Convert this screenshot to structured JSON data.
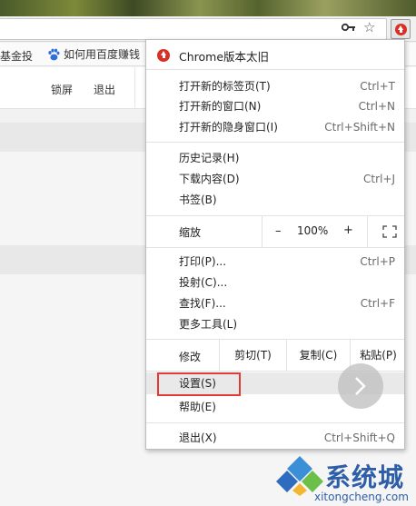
{
  "bookmarks": {
    "item1": "基金投",
    "item2": "如何用百度赚钱"
  },
  "page": {
    "lock_label": "锁屏",
    "exit_label": "退出"
  },
  "menu": {
    "update": {
      "label": "Chrome版本太旧",
      "icon": "update-icon",
      "color": "#d93025"
    },
    "new_tab": {
      "label": "打开新的标签页(T)",
      "shortcut": "Ctrl+T"
    },
    "new_window": {
      "label": "打开新的窗口(N)",
      "shortcut": "Ctrl+N"
    },
    "incognito": {
      "label": "打开新的隐身窗口(I)",
      "shortcut": "Ctrl+Shift+N"
    },
    "history": {
      "label": "历史记录(H)"
    },
    "downloads": {
      "label": "下载内容(D)",
      "shortcut": "Ctrl+J"
    },
    "bookmarks": {
      "label": "书签(B)"
    },
    "zoom": {
      "label": "缩放",
      "minus": "–",
      "value": "100%",
      "plus": "+"
    },
    "print": {
      "label": "打印(P)...",
      "shortcut": "Ctrl+P"
    },
    "cast": {
      "label": "投射(C)..."
    },
    "find": {
      "label": "查找(F)...",
      "shortcut": "Ctrl+F"
    },
    "more_tools": {
      "label": "更多工具(L)"
    },
    "edit": {
      "label": "修改",
      "cut": "剪切(T)",
      "copy": "复制(C)",
      "paste": "粘贴(P)"
    },
    "settings": {
      "label": "设置(S)",
      "highlight_color": "#e53935"
    },
    "help": {
      "label": "帮助(E)"
    },
    "exit": {
      "label": "退出(X)",
      "shortcut": "Ctrl+Shift+Q"
    }
  },
  "watermark": {
    "text": "系统城",
    "url": "xitongcheng.com"
  }
}
